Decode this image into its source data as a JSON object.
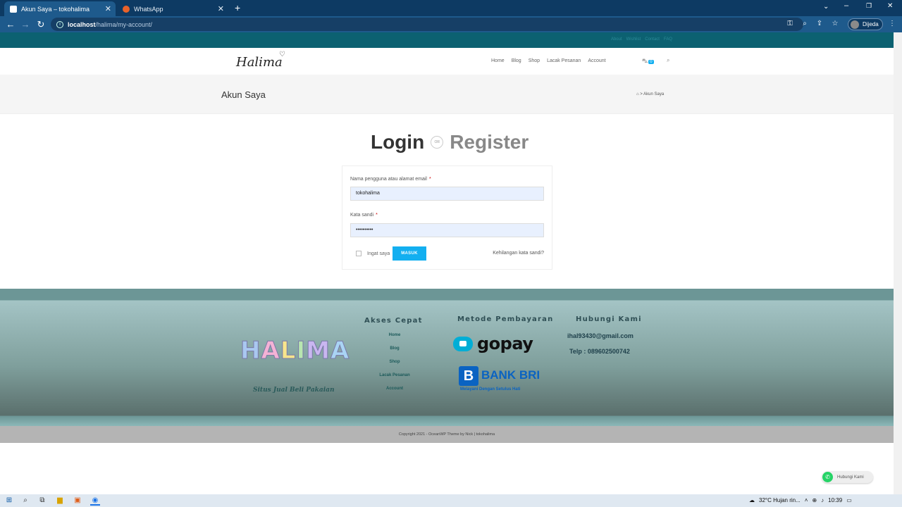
{
  "browser": {
    "tabs": [
      {
        "title": "Akun Saya – tokohalima",
        "active": true
      },
      {
        "title": "WhatsApp",
        "active": false
      }
    ],
    "new_tab_label": "+",
    "url_host": "localhost",
    "url_path": "/halima/my-account/",
    "profile_label": "Dijeda"
  },
  "site": {
    "topbar_links": [
      "About",
      "Wishlist",
      "Contact",
      "FAQ"
    ],
    "logo_text": "Halima",
    "nav": [
      "Home",
      "Blog",
      "Shop",
      "Lacak Pesanan",
      "Account"
    ],
    "cart_count": "0",
    "page_title": "Akun Saya",
    "breadcrumb_current": "Akun Saya"
  },
  "login": {
    "heading_login": "Login",
    "heading_or": "OR",
    "heading_register": "Register",
    "username_label": "Nama pengguna atau alamat email",
    "username_value": "tokohalima",
    "password_label": "Kata sandi",
    "password_value": "••••••••••",
    "required_mark": "*",
    "remember_label": "Ingat saya",
    "submit_label": "MASUK",
    "lost_password": "Kehilangan kata sandi?"
  },
  "footer": {
    "brand_letters": [
      "H",
      "A",
      "L",
      "I",
      "M",
      "A"
    ],
    "tagline": "Situs Jual Beli Pakaian",
    "quick_title": "Akses Cepat",
    "quick_links": [
      "Home",
      "Blog",
      "Shop",
      "Lacak Pesanan",
      "Account"
    ],
    "payment_title": "Metode Pembayaran",
    "gopay_label": "gopay",
    "bri_label": "BANK BRI",
    "bri_slogan": "Melayani Dengan Setulus Hati",
    "contact_title": "Hubungi Kami",
    "contact_email": "ihal93430@gmail.com",
    "contact_phone": "Telp : 089602500742",
    "copyright": "Copyright 2021 - OceanWP Theme by Nick | tokohalima"
  },
  "whatsapp_button": "Hubungi Kami",
  "taskbar": {
    "weather": "32°C  Hujan rin...",
    "time": "10:39"
  },
  "colors": {
    "accent": "#13aff0",
    "topbar": "#0c6171",
    "browser_frame": "#0d3a63"
  }
}
